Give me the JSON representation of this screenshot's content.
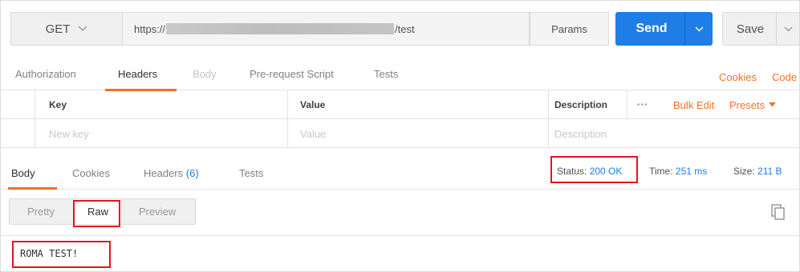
{
  "request": {
    "method": "GET",
    "url_prefix": "https://",
    "url_suffix": "/test",
    "params_label": "Params",
    "send_label": "Send",
    "save_label": "Save"
  },
  "request_tabs": [
    "Authorization",
    "Headers",
    "Body",
    "Pre-request Script",
    "Tests"
  ],
  "request_links": {
    "cookies": "Cookies",
    "code": "Code"
  },
  "headers_table": {
    "columns": [
      "Key",
      "Value",
      "Description"
    ],
    "more_label": "•••",
    "bulk_edit": "Bulk Edit",
    "presets": "Presets",
    "placeholders": {
      "key": "New key",
      "value": "Value",
      "description": "Description"
    }
  },
  "response": {
    "tabs": {
      "body": "Body",
      "cookies": "Cookies",
      "headers": "Headers",
      "headers_count": "(6)",
      "tests": "Tests"
    },
    "status_label": "Status:",
    "status_value": "200 OK",
    "time_label": "Time:",
    "time_value": "251 ms",
    "size_label": "Size:",
    "size_value": "211 B",
    "view_modes": [
      "Pretty",
      "Raw",
      "Preview"
    ],
    "selected_view": "Raw",
    "body_text": "ROMA TEST!"
  },
  "colors": {
    "accent": "#f47023",
    "send": "#1e7de6",
    "link_blue": "#1e7de6",
    "highlight": "#e5131d"
  },
  "icons": [
    "chevron-down-icon",
    "caret-down-icon",
    "copy-icon"
  ]
}
